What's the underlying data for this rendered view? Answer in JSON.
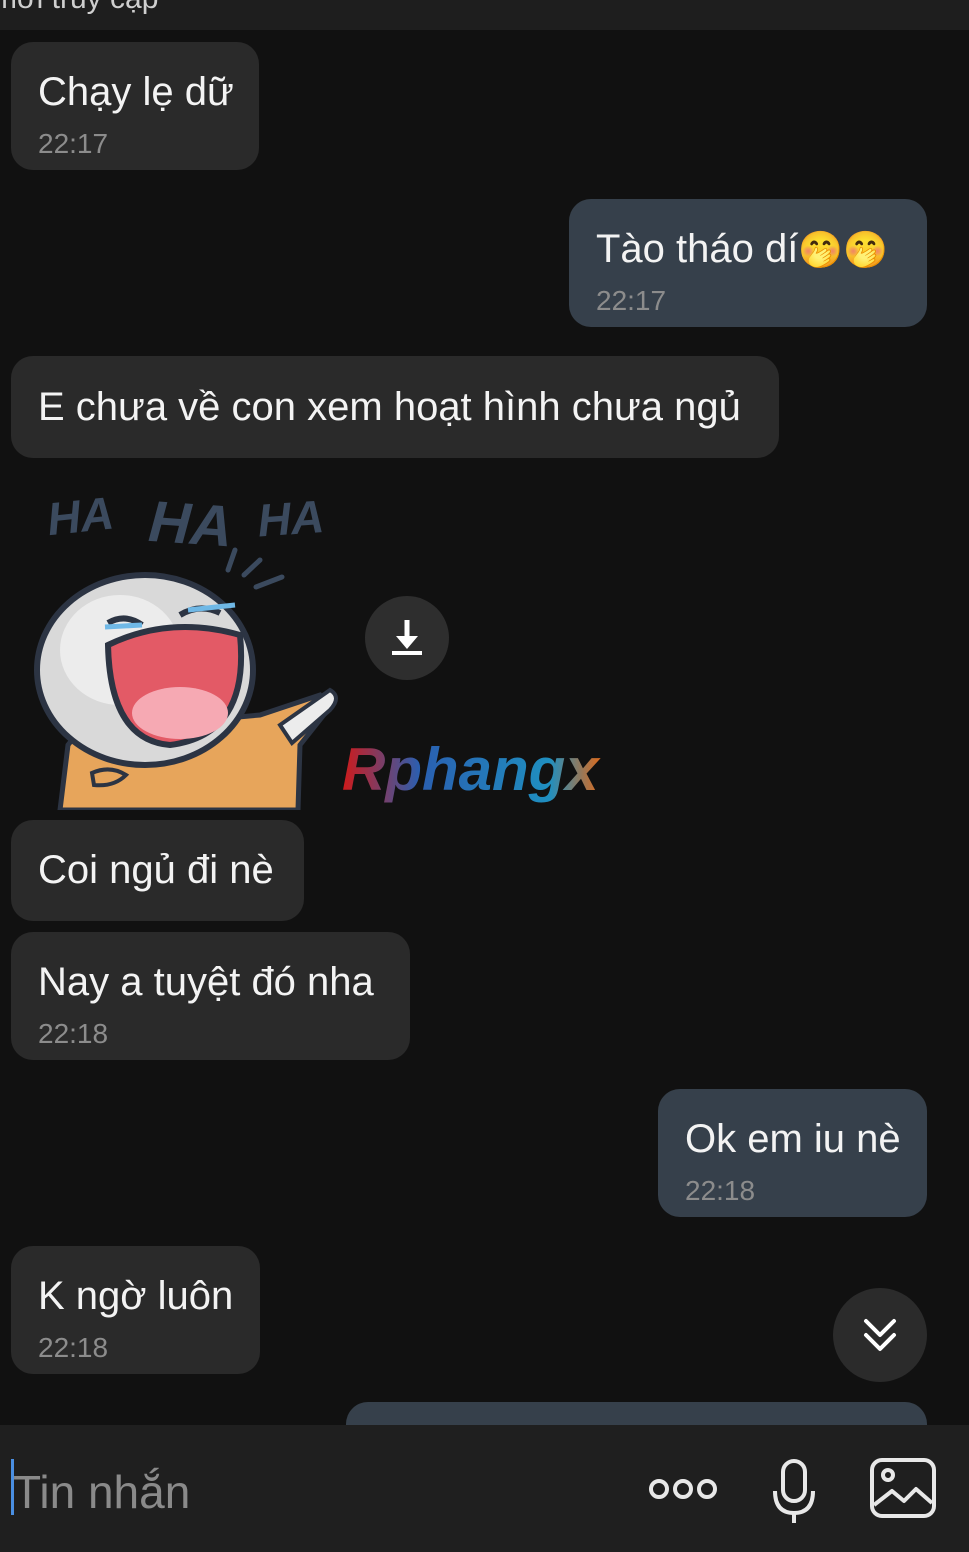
{
  "header": {
    "title_fragment": "mới truy cập"
  },
  "messages": [
    {
      "text": "Chạy lẹ dữ",
      "time": "22:17"
    },
    {
      "text": "Tào tháo dí",
      "emoji": "🤭🤭",
      "time": "22:17"
    },
    {
      "text": "E chưa về con xem hoạt hình chưa ngủ"
    },
    {
      "sticker": {
        "caption_top": [
          "HA",
          "HA",
          "HA"
        ],
        "watermark": "Rphangx"
      }
    },
    {
      "text": "Coi ngủ đi nè"
    },
    {
      "text": "Nay a tuyệt đó nha",
      "time": "22:18"
    },
    {
      "text": "Ok em iu nè",
      "time": "22:18"
    },
    {
      "text": "K ngờ luôn",
      "time": "22:18"
    }
  ],
  "composer": {
    "placeholder": "Tin nhắn"
  },
  "icons": {
    "download": "download-icon",
    "scroll_down": "double-chevron-down-icon",
    "more": "more-dots-icon",
    "mic": "microphone-icon",
    "image": "image-icon"
  },
  "colors": {
    "accent_cursor": "#4a8fe2",
    "incoming_bubble": "#2a2a2a",
    "outgoing_bubble": "#36404b"
  }
}
